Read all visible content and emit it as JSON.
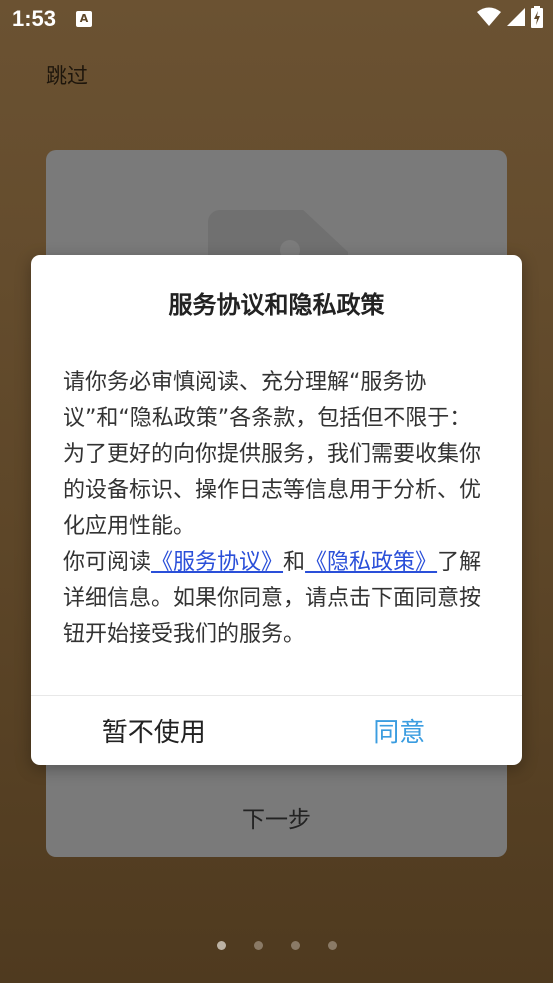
{
  "status_bar": {
    "time": "1:53",
    "notification_icon": "A",
    "icons": [
      "wifi-icon",
      "signal-icon",
      "battery-icon"
    ]
  },
  "skip_label": "跳过",
  "background_card": {
    "next_button_label": "下一步"
  },
  "pager": {
    "count": 4,
    "active_index": 0
  },
  "dialog": {
    "title": "服务协议和隐私政策",
    "paragraph1": "请你务必审慎阅读、充分理解“服务协议”和“隐私政策”各条款，包括但不限于：为了更好的向你提供服务，我们需要收集你的设备标识、操作日志等信息用于分析、优化应用性能。",
    "paragraph2_prefix": "你可阅读",
    "link_service": "《服务协议》",
    "paragraph2_and": "和",
    "link_privacy": "《隐私政策》",
    "paragraph2_suffix": "了解详细信息。如果你同意，请点击下面同意按钮开始接受我们的服务。",
    "cancel_label": "暂不使用",
    "agree_label": "同意"
  },
  "colors": {
    "background": "#5d4628",
    "link": "#2a4fd9",
    "agree": "#3b9de0"
  }
}
